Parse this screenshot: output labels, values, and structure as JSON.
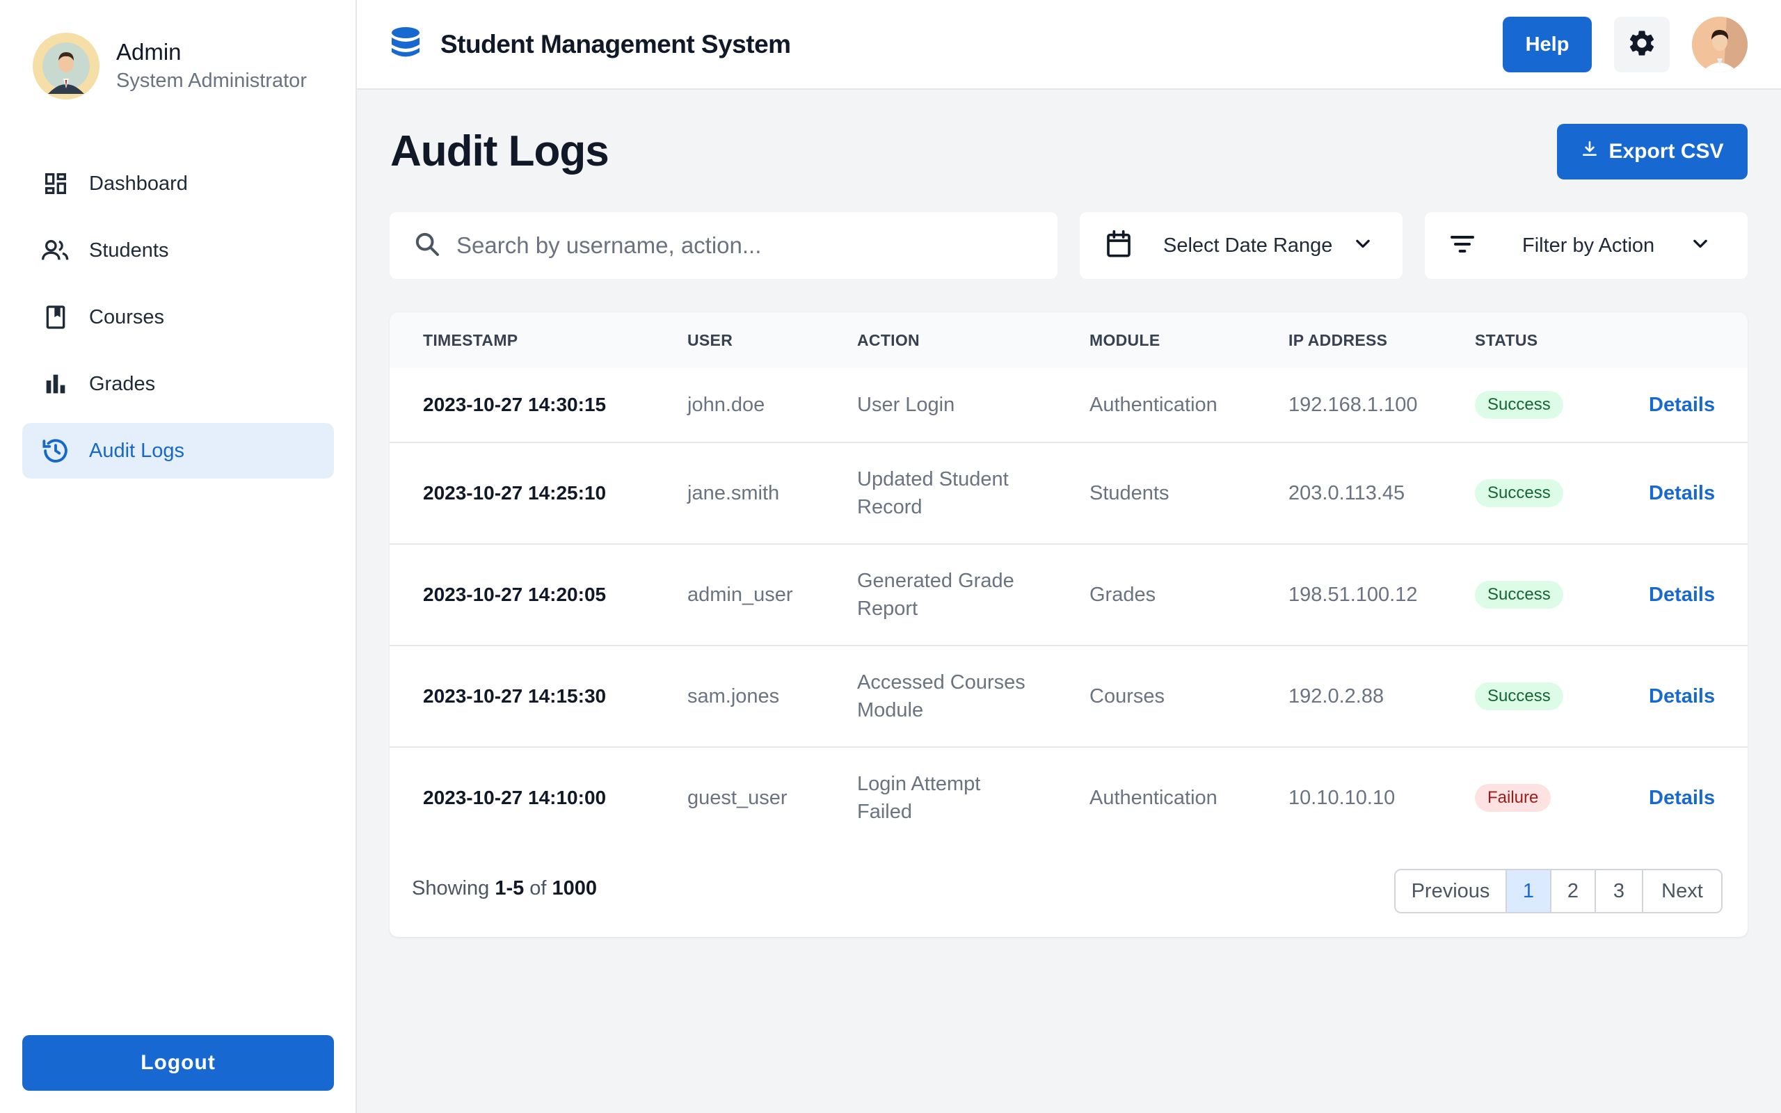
{
  "sidebar": {
    "profile": {
      "name": "Admin",
      "role": "System Administrator"
    },
    "items": [
      {
        "label": "Dashboard",
        "icon": "dashboard-icon"
      },
      {
        "label": "Students",
        "icon": "people-icon"
      },
      {
        "label": "Courses",
        "icon": "book-icon"
      },
      {
        "label": "Grades",
        "icon": "bar-chart-icon"
      },
      {
        "label": "Audit Logs",
        "icon": "history-icon",
        "active": true
      }
    ],
    "logout_label": "Logout"
  },
  "header": {
    "title": "Student Management System",
    "help_label": "Help"
  },
  "main": {
    "title": "Audit Logs",
    "export_label": "Export CSV",
    "search_placeholder": "Search by username, action...",
    "date_range_label": "Select Date Range",
    "filter_label": "Filter by Action"
  },
  "table": {
    "columns": [
      "TIMESTAMP",
      "USER",
      "ACTION",
      "MODULE",
      "IP ADDRESS",
      "STATUS"
    ],
    "details_label": "Details",
    "rows": [
      {
        "timestamp": "2023-10-27 14:30:15",
        "user": "john.doe",
        "action": "User Login",
        "module": "Authentication",
        "ip": "192.168.1.100",
        "status": "Success"
      },
      {
        "timestamp": "2023-10-27 14:25:10",
        "user": "jane.smith",
        "action": "Updated Student Record",
        "module": "Students",
        "ip": "203.0.113.45",
        "status": "Success"
      },
      {
        "timestamp": "2023-10-27 14:20:05",
        "user": "admin_user",
        "action": "Generated Grade Report",
        "module": "Grades",
        "ip": "198.51.100.12",
        "status": "Success"
      },
      {
        "timestamp": "2023-10-27 14:15:30",
        "user": "sam.jones",
        "action": "Accessed Courses Module",
        "module": "Courses",
        "ip": "192.0.2.88",
        "status": "Success"
      },
      {
        "timestamp": "2023-10-27 14:10:00",
        "user": "guest_user",
        "action": "Login Attempt Failed",
        "module": "Authentication",
        "ip": "10.10.10.10",
        "status": "Failure"
      }
    ]
  },
  "pagination": {
    "showing_prefix": "Showing",
    "range": "1-5",
    "of_label": "of",
    "total": "1000",
    "previous_label": "Previous",
    "pages": [
      "1",
      "2",
      "3"
    ],
    "current_page": "1",
    "next_label": "Next"
  },
  "colors": {
    "accent": "#1769d1",
    "success_bg": "#dcfce7",
    "failure_bg": "#fee2e2"
  }
}
